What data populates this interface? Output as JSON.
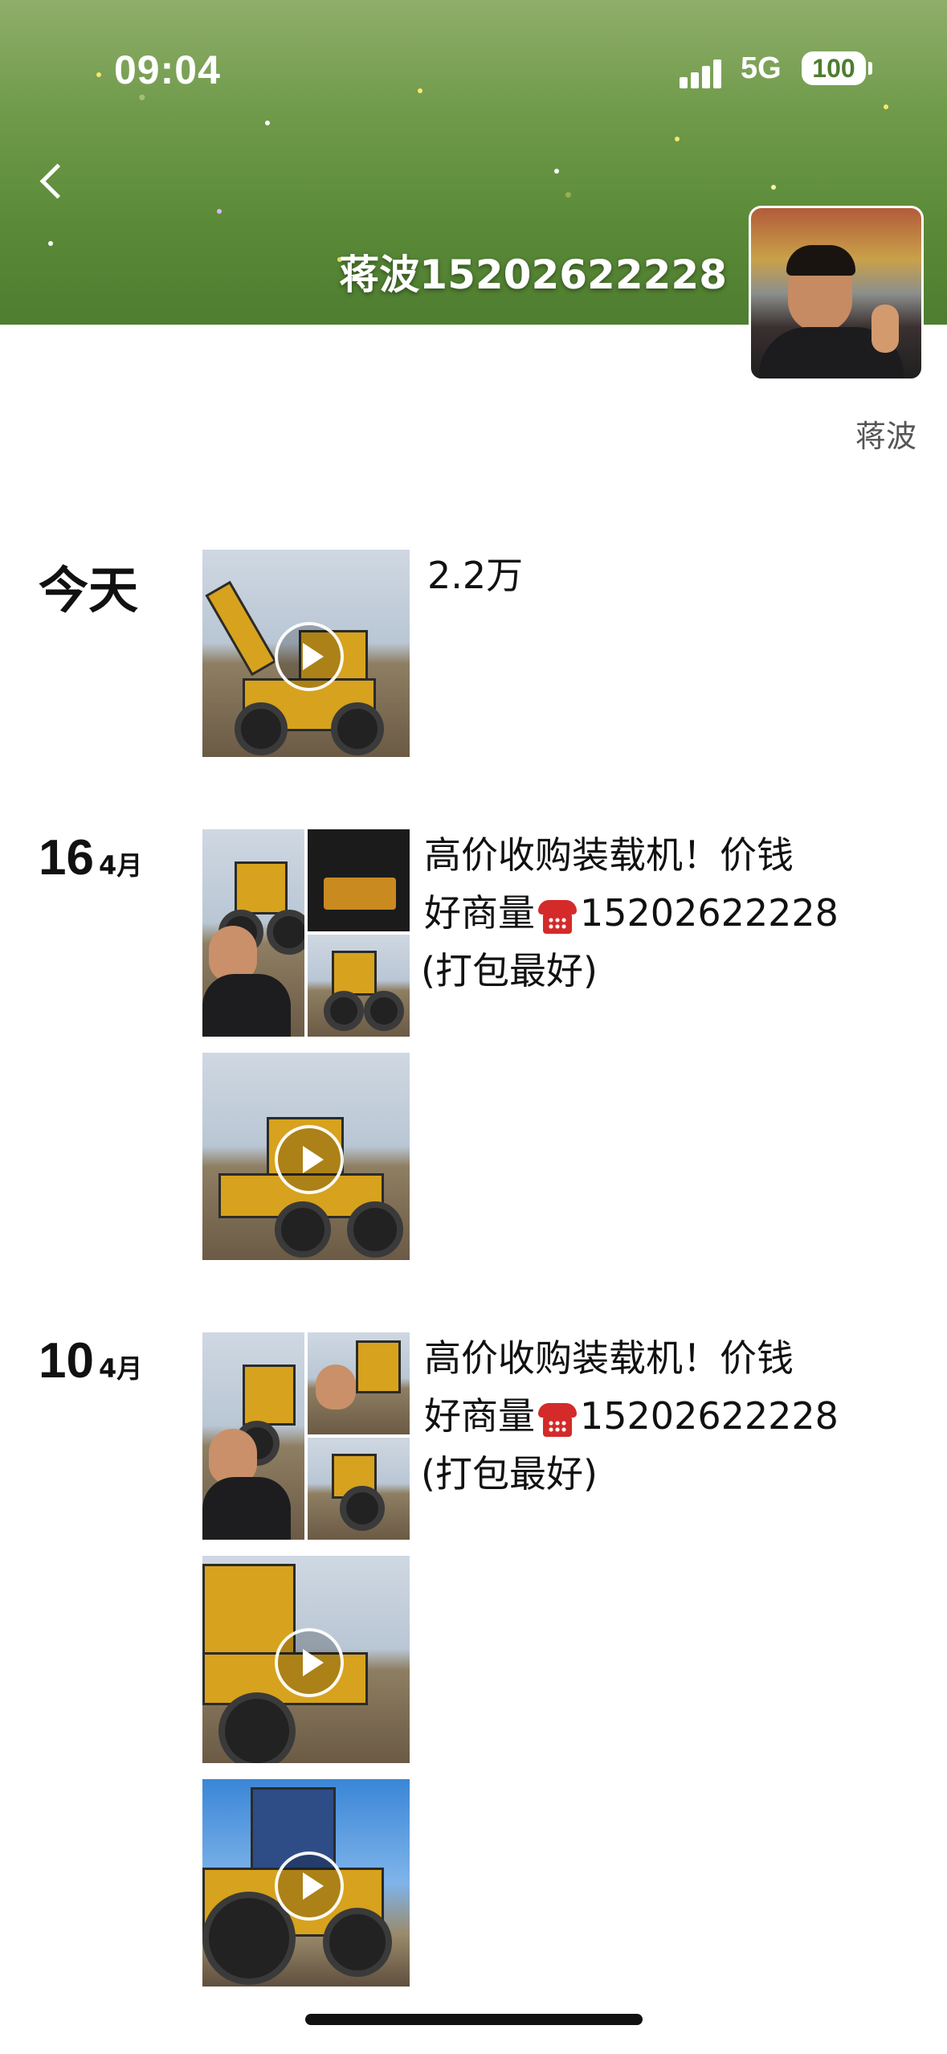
{
  "status_bar": {
    "time": "09:04",
    "network": "5G",
    "battery": "100"
  },
  "header": {
    "cover_title": "蒋波15202622228",
    "profile_name": "蒋波",
    "back_icon": "chevron-left-icon"
  },
  "posts": [
    {
      "day_label": "今天",
      "caption_lines": [
        "2.2万"
      ]
    },
    {
      "day": "16",
      "month": "4月",
      "caption_line1": "高价收购装载机！价钱",
      "caption_line2_before": "好商量",
      "caption_line2_phone": "15202622228",
      "caption_line3": "(打包最好)",
      "phone_icon": "telephone-icon"
    },
    {
      "day": "10",
      "month": "4月",
      "caption_line1": "高价收购装载机！价钱",
      "caption_line2_before": "好商量",
      "caption_line2_phone": "15202622228",
      "caption_line3": "(打包最好)",
      "phone_icon": "telephone-icon"
    }
  ]
}
